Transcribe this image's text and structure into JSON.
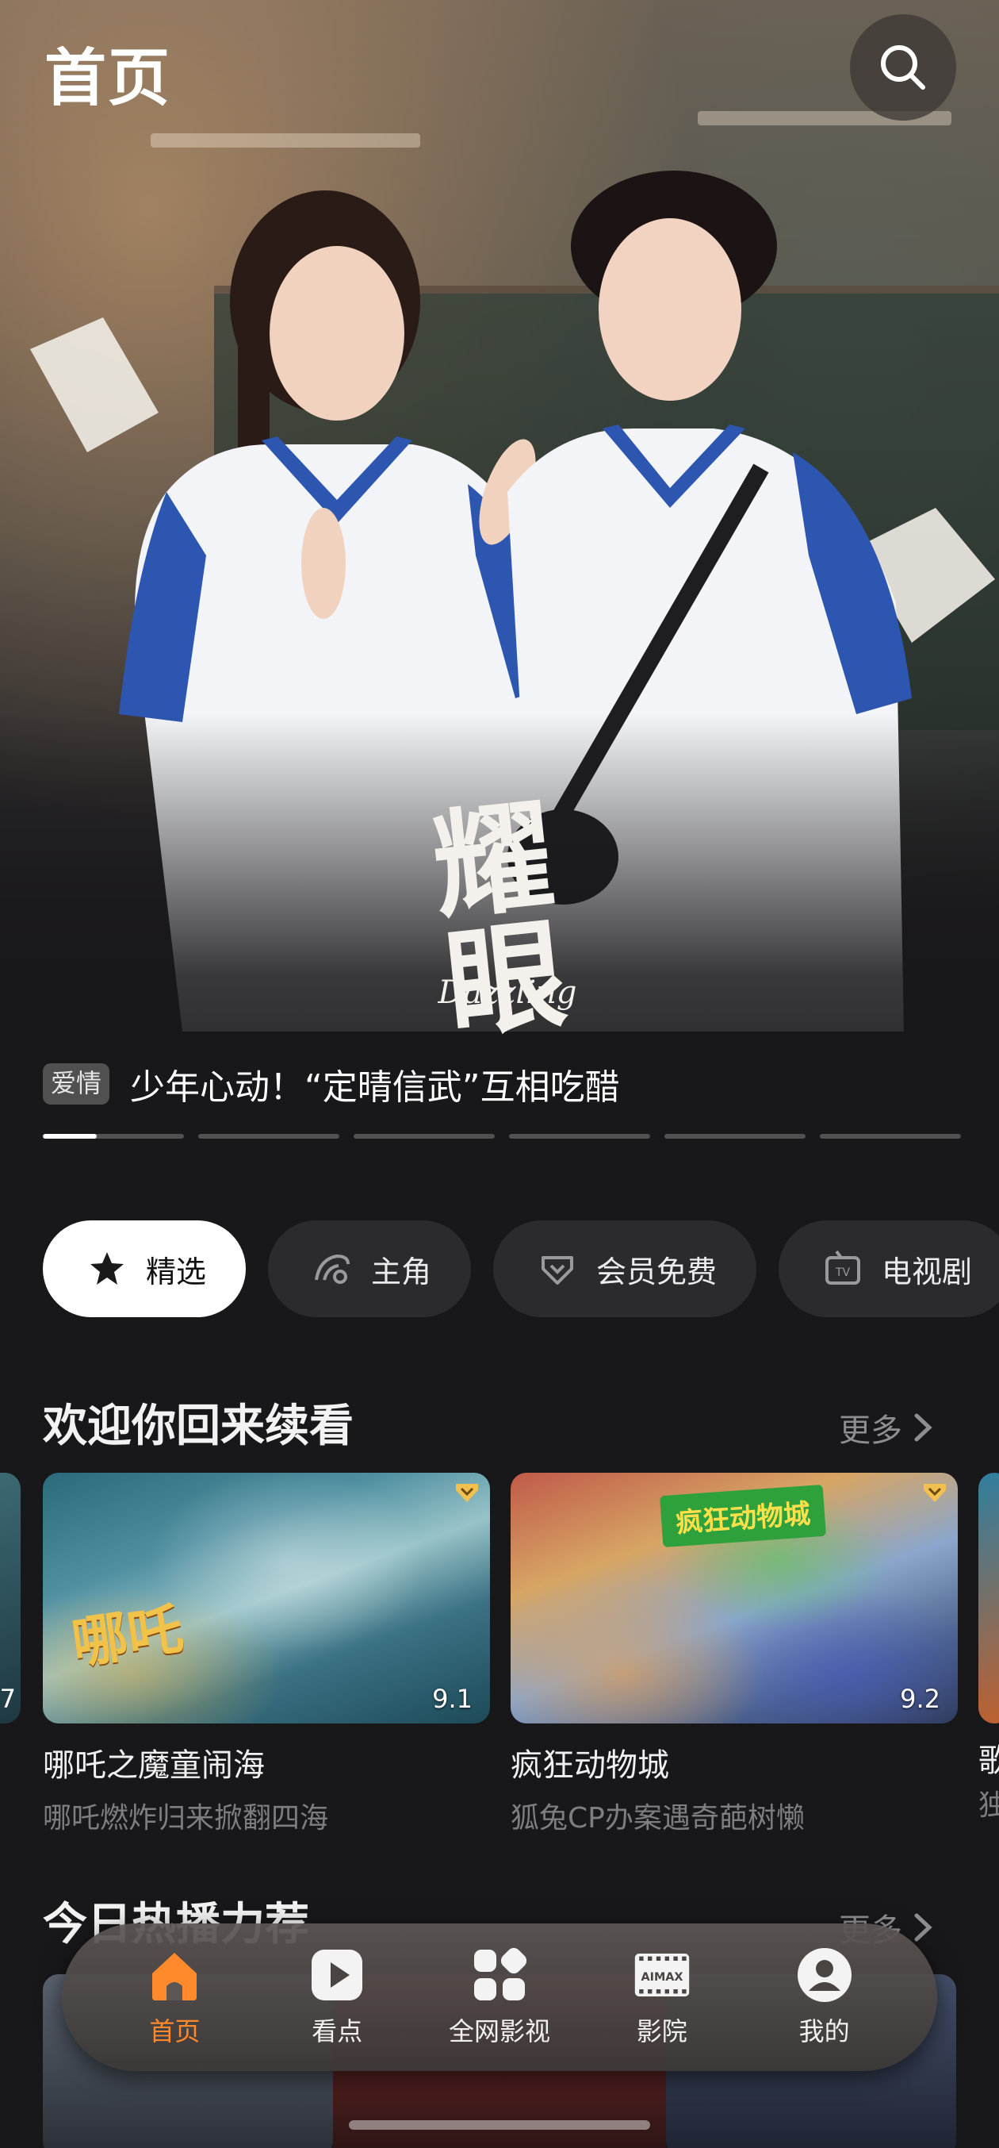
{
  "header": {
    "title": "首页"
  },
  "banner": {
    "logo_text": "耀眼",
    "logo_subtitle": "Dazzling",
    "tag": "爱情",
    "caption": "少年心动！“定晴信武”互相吃醋",
    "slide_count": 6,
    "active_slide": 1,
    "active_progress": 0.38
  },
  "chips": [
    {
      "label": "精选",
      "icon": "star-icon",
      "active": true
    },
    {
      "label": "主角",
      "icon": "protagonist-icon",
      "active": false
    },
    {
      "label": "会员免费",
      "icon": "vip-diamond-icon",
      "active": false
    },
    {
      "label": "电视剧",
      "icon": "tv-icon",
      "active": false
    }
  ],
  "continue_watching": {
    "title": "欢迎你回来续看",
    "more": "更多",
    "cards": [
      {
        "title": "哪吒之魔童闹海",
        "subtitle": "哪吒燃炸归来掀翻四海",
        "score": "9.1",
        "vip": true
      },
      {
        "title": "疯狂动物城",
        "subtitle": "狐兔CP办案遇奇葩树懒",
        "score": "9.2",
        "vip": true,
        "poster_text": "疯狂动物城"
      }
    ],
    "left_peek_score": "7",
    "right_peek_title": "歌",
    "right_peek_subtitle": "独"
  },
  "today_hot": {
    "title": "今日热播力荐",
    "more": "更多"
  },
  "bottom_nav": [
    {
      "label": "首页",
      "icon": "home-icon",
      "active": true
    },
    {
      "label": "看点",
      "icon": "play-icon",
      "active": false
    },
    {
      "label": "全网影视",
      "icon": "grid-icon",
      "active": false
    },
    {
      "label": "影院",
      "icon": "imax-icon",
      "active": false,
      "icon_text": "AIMAX"
    },
    {
      "label": "我的",
      "icon": "profile-icon",
      "active": false
    }
  ],
  "colors": {
    "accent": "#ff8a2c",
    "background": "#181719",
    "chip_bg": "#2b2a2d"
  }
}
